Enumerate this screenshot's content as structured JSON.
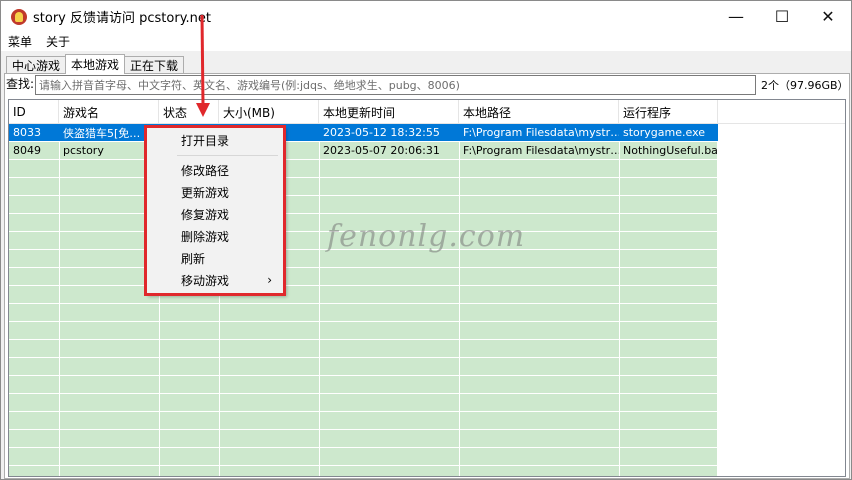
{
  "window": {
    "title": "story 反馈请访问 pcstory.net",
    "controls": {
      "minimize": "—",
      "maximize": "☐",
      "close": "✕"
    }
  },
  "menubar": {
    "items": [
      "菜单",
      "关于"
    ]
  },
  "tabs": [
    {
      "label": "中心游戏",
      "active": false
    },
    {
      "label": "本地游戏",
      "active": true
    },
    {
      "label": "正在下载",
      "active": false
    }
  ],
  "search": {
    "label": "查找:",
    "placeholder": "请输入拼音首字母、中文字符、英文名、游戏编号(例:jdqs、绝地求生、pubg、8006)",
    "value": ""
  },
  "count_label": "2个（97.96GB）",
  "table": {
    "columns": [
      "ID",
      "游戏名",
      "状态",
      "大小(MB)",
      "本地更新时间",
      "本地路径",
      "运行程序"
    ],
    "rows": [
      {
        "id": "8033",
        "name": "侠盗猎车5[免…",
        "status": "",
        "size": "",
        "updated": "2023-05-12 18:32:55",
        "path": "F:\\Program Filesdata\\mystr…",
        "exe": "storygame.exe",
        "selected": true
      },
      {
        "id": "8049",
        "name": "pcstory",
        "status": "",
        "size": "",
        "updated": "2023-05-07 20:06:31",
        "path": "F:\\Program Filesdata\\mystr…",
        "exe": "NothingUseful.bat",
        "selected": false
      }
    ]
  },
  "context_menu": {
    "items": [
      "打开目录",
      "修改路径",
      "更新游戏",
      "修复游戏",
      "删除游戏",
      "刷新",
      "移动游戏"
    ],
    "submenu_arrow": "›"
  },
  "annotation": {
    "highlight_color": "#e0282c"
  },
  "watermark": "fenonlg.com",
  "colors": {
    "selection": "#0078d7",
    "row_fill": "#cde8cd",
    "accent": "#e0282c"
  }
}
